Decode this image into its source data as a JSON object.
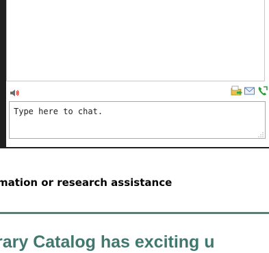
{
  "chat": {
    "input_placeholder": "Type here to chat.",
    "icons": {
      "speaker": "speaker-volume-icon",
      "file": "send-file-icon",
      "email": "email-transcript-icon",
      "phone": "call-icon"
    },
    "colors": {
      "frame": "#1f1f1f",
      "border": "#c8c8c8",
      "speaker": "#d73a2f"
    }
  },
  "page": {
    "info_text": "mation or research assistance",
    "headline": "rary Catalog has exciting u",
    "colors": {
      "divider": "#5d7a73",
      "headline": "#40776f"
    }
  }
}
